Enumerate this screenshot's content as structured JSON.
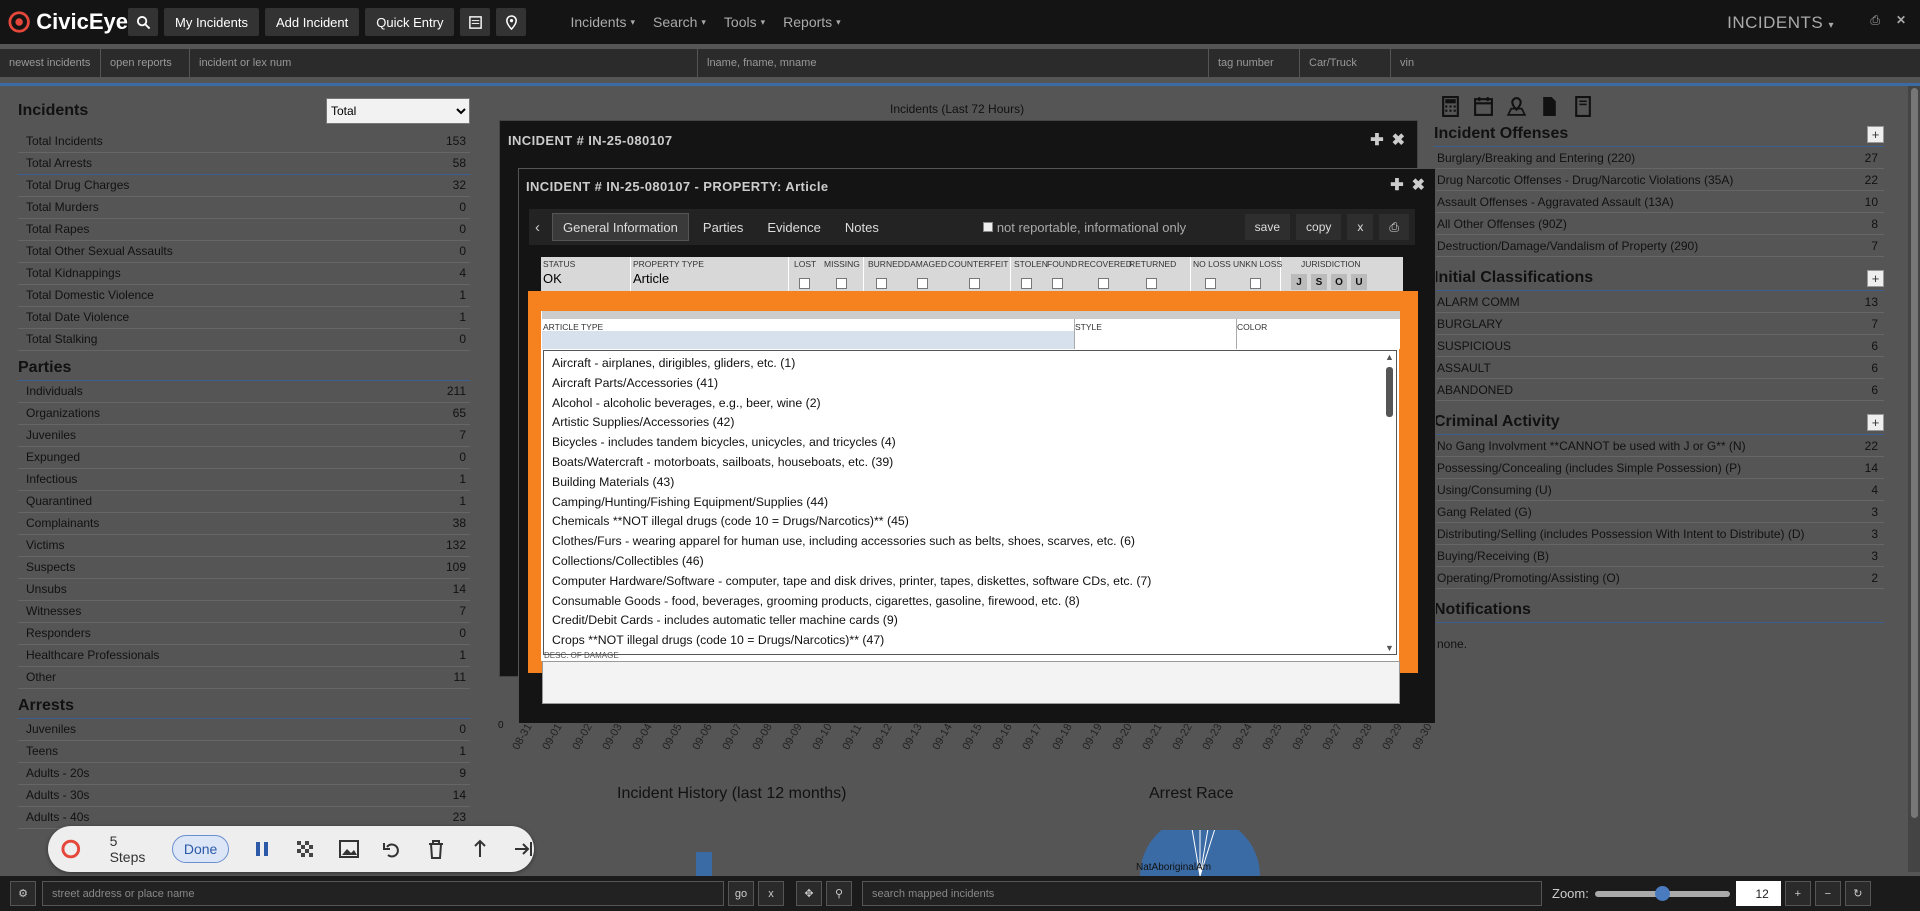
{
  "app": {
    "name": "CivicEye",
    "module_title": "INCIDENTS"
  },
  "topbar": {
    "buttons": [
      "My Incidents",
      "Add Incident",
      "Quick Entry"
    ],
    "menus": [
      "Incidents",
      "Search",
      "Tools",
      "Reports"
    ]
  },
  "searchbar": {
    "newest": "newest incidents",
    "open": "open reports",
    "incident_ph": "incident or lex num",
    "name_ph": "lname, fname, mname",
    "tag_ph": "tag number",
    "car_ph": "Car/Truck",
    "vin_ph": "vin"
  },
  "incidents": {
    "title": "Incidents",
    "select_value": "Total",
    "items": [
      {
        "label": "Total Incidents",
        "value": "153"
      },
      {
        "label": "Total Arrests",
        "value": "58"
      },
      {
        "label": "Total Drug Charges",
        "value": "32"
      },
      {
        "label": "Total Murders",
        "value": "0"
      },
      {
        "label": "Total Rapes",
        "value": "0"
      },
      {
        "label": "Total Other Sexual Assaults",
        "value": "0"
      },
      {
        "label": "Total Kidnappings",
        "value": "4"
      },
      {
        "label": "Total Domestic Violence",
        "value": "1"
      },
      {
        "label": "Total Date Violence",
        "value": "1"
      },
      {
        "label": "Total Stalking",
        "value": "0"
      }
    ]
  },
  "parties": {
    "title": "Parties",
    "items": [
      {
        "label": "Individuals",
        "value": "211"
      },
      {
        "label": "Organizations",
        "value": "65"
      },
      {
        "label": "Juveniles",
        "value": "7"
      },
      {
        "label": "Expunged",
        "value": "0"
      },
      {
        "label": "Infectious",
        "value": "1"
      },
      {
        "label": "Quarantined",
        "value": "1"
      },
      {
        "label": "Complainants",
        "value": "38"
      },
      {
        "label": "Victims",
        "value": "132"
      },
      {
        "label": "Suspects",
        "value": "109"
      },
      {
        "label": "Unsubs",
        "value": "14"
      },
      {
        "label": "Witnesses",
        "value": "7"
      },
      {
        "label": "Responders",
        "value": "0"
      },
      {
        "label": "Healthcare Professionals",
        "value": "1"
      },
      {
        "label": "Other",
        "value": "11"
      }
    ]
  },
  "arrests": {
    "title": "Arrests",
    "items": [
      {
        "label": "Juveniles",
        "value": "0"
      },
      {
        "label": "Teens",
        "value": "1"
      },
      {
        "label": "Adults - 20s",
        "value": "9"
      },
      {
        "label": "Adults - 30s",
        "value": "14"
      },
      {
        "label": "Adults - 40s",
        "value": "23"
      }
    ]
  },
  "offenses": {
    "title": "Incident Offenses",
    "items": [
      {
        "label": "Burglary/Breaking and Entering (220)",
        "value": "27"
      },
      {
        "label": "Drug Narcotic Offenses - Drug/Narcotic Violations (35A)",
        "value": "22"
      },
      {
        "label": "Assault Offenses - Aggravated Assault (13A)",
        "value": "10"
      },
      {
        "label": "All Other Offenses (90Z)",
        "value": "8"
      },
      {
        "label": "Destruction/Damage/Vandalism of Property (290)",
        "value": "7"
      }
    ]
  },
  "classifications": {
    "title": "Initial Classifications",
    "items": [
      {
        "label": "ALARM COMM",
        "value": "13"
      },
      {
        "label": "BURGLARY",
        "value": "7"
      },
      {
        "label": "SUSPICIOUS",
        "value": "6"
      },
      {
        "label": "ASSAULT",
        "value": "6"
      },
      {
        "label": "ABANDONED",
        "value": "6"
      }
    ]
  },
  "criminal": {
    "title": "Criminal Activity",
    "items": [
      {
        "label": "No Gang Involvment **CANNOT be used with J or G** (N)",
        "value": "22"
      },
      {
        "label": "Possessing/Concealing (includes Simple Possession) (P)",
        "value": "14"
      },
      {
        "label": "Using/Consuming (U)",
        "value": "4"
      },
      {
        "label": "Gang Related (G)",
        "value": "3"
      },
      {
        "label": "Distributing/Selling (includes Possession With Intent to Distribute) (D)",
        "value": "3"
      },
      {
        "label": "Buying/Receiving (B)",
        "value": "3"
      },
      {
        "label": "Operating/Promoting/Assisting (O)",
        "value": "2"
      }
    ]
  },
  "notifications": {
    "title": "Notifications",
    "text": "none."
  },
  "charts": {
    "last72_title": "Incidents (Last 72 Hours)",
    "history_title": "Incident History (last 12 months)",
    "race_title": "Arrest Race",
    "zero": "0",
    "dates": [
      "09-01",
      "09-02",
      "09-03",
      "09-04",
      "09-05",
      "09-06",
      "09-07",
      "09-08",
      "09-09",
      "09-10",
      "09-11",
      "09-12",
      "09-13",
      "09-14",
      "09-15",
      "09-16",
      "09-17",
      "09-18",
      "09-19",
      "09-20",
      "09-21",
      "09-22",
      "09-23",
      "09-24",
      "09-25",
      "09-26",
      "09-27",
      "09-28",
      "09-29",
      "09-30"
    ],
    "first_date": "08-31",
    "race_label": "NatAboriginalAm"
  },
  "window1": {
    "title": "INCIDENT # IN-25-080107"
  },
  "window2": {
    "title": "INCIDENT # IN-25-080107 - PROPERTY: Article",
    "tabs": [
      "General Information",
      "Parties",
      "Evidence",
      "Notes"
    ],
    "not_reportable": "not reportable, informational only",
    "actions": {
      "save": "save",
      "copy": "copy",
      "close": "x"
    },
    "fields": {
      "status_label": "STATUS",
      "status_value": "OK",
      "ptype_label": "PROPERTY TYPE",
      "ptype_value": "Article",
      "lost": "LOST",
      "missing": "MISSING",
      "burned": "BURNED",
      "damaged": "DAMAGED",
      "counterfeit": "COUNTERFEIT",
      "stolen": "STOLEN",
      "found": "FOUND",
      "recovered": "RECOVERED",
      "returned": "RETURNED",
      "noloss": "NO LOSS",
      "unkn": "UNKN LOSS",
      "juris": "JURISDICTION",
      "juris_letters": [
        "J",
        "S",
        "O",
        "U"
      ]
    },
    "article_type_label": "ARTICLE TYPE",
    "style_label": "STYLE",
    "color_label": "COLOR",
    "desc_label": "DESC. OF DAMAGE",
    "options": [
      "Aircraft - airplanes, dirigibles, gliders, etc. (1)",
      "Aircraft Parts/Accessories (41)",
      "Alcohol - alcoholic beverages, e.g., beer, wine (2)",
      "Artistic Supplies/Accessories (42)",
      "Bicycles - includes tandem bicycles, unicycles, and tricycles (4)",
      "Boats/Watercraft - motorboats, sailboats, houseboats, etc. (39)",
      "Building Materials (43)",
      "Camping/Hunting/Fishing Equipment/Supplies (44)",
      "Chemicals **NOT illegal drugs (code 10 = Drugs/Narcotics)** (45)",
      "Clothes/Furs - wearing apparel for human use, including accessories such as belts, shoes, scarves, etc. (6)",
      "Collections/Collectibles (46)",
      "Computer Hardware/Software - computer, tape and disk drives, printer, tapes, diskettes, software CDs, etc. (7)",
      "Consumable Goods - food, beverages, grooming products, cigarettes, gasoline, firewood, etc. (8)",
      "Credit/Debit Cards - includes automatic teller machine cards (9)",
      "Crops **NOT illegal drugs (code 10 = Drugs/Narcotics)** (47)"
    ]
  },
  "recorder": {
    "steps": "5 Steps",
    "done": "Done"
  },
  "bottombar": {
    "address_ph": "street address or place name",
    "go": "go",
    "x": "x",
    "mapped_ph": "search mapped incidents",
    "zoom_label": "Zoom:",
    "zoom_value": "12",
    "zoom_level": 0.5,
    "plus": "+",
    "minus": "−"
  }
}
